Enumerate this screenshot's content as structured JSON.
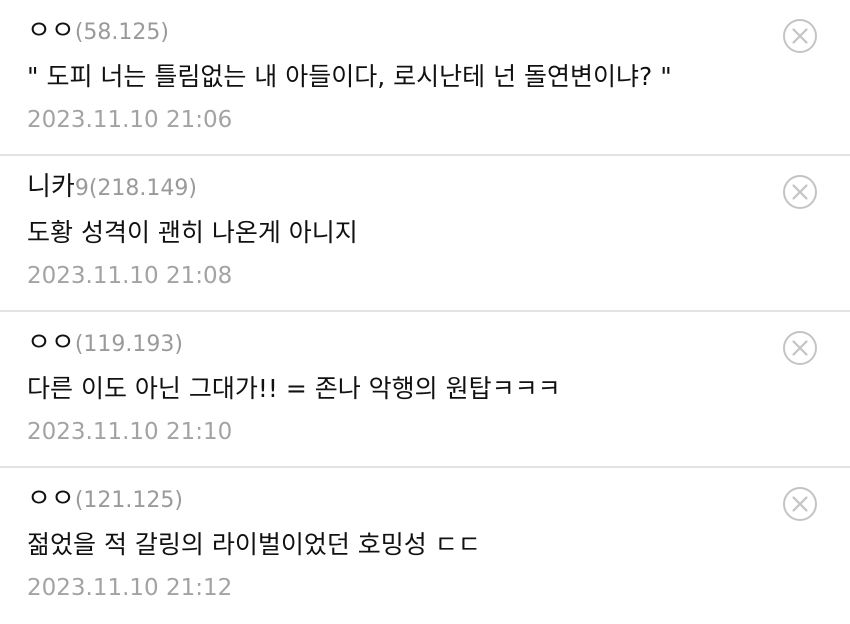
{
  "comments": [
    {
      "nickname": "ㅇㅇ",
      "ip": "(58.125)",
      "text": "\" 도피 너는 틀림없는 내 아들이다, 로시난테 넌 돌연변이냐? \"",
      "timestamp": "2023.11.10 21:06",
      "delete_icon": "circle-x-icon"
    },
    {
      "nickname": "니카",
      "nickname_suffix": "9",
      "ip": "(218.149)",
      "text": "도황 성격이 괜히 나온게 아니지",
      "timestamp": "2023.11.10 21:08",
      "delete_icon": "circle-x-icon"
    },
    {
      "nickname": "ㅇㅇ",
      "ip": "(119.193)",
      "text": "다른 이도 아닌 그대가!! = 존나 악행의 원탑ㅋㅋㅋ",
      "timestamp": "2023.11.10 21:10",
      "delete_icon": "circle-x-icon"
    },
    {
      "nickname": "ㅇㅇ",
      "ip": "(121.125)",
      "text": "젊었을 적 갈링의 라이벌이었던 호밍성 ㄷㄷ",
      "timestamp": "2023.11.10 21:12",
      "delete_icon": "circle-x-icon"
    }
  ],
  "colors": {
    "text": "#111111",
    "meta": "#9a9a9a",
    "divider": "#e3e3e3",
    "icon": "#c4c4c4"
  }
}
